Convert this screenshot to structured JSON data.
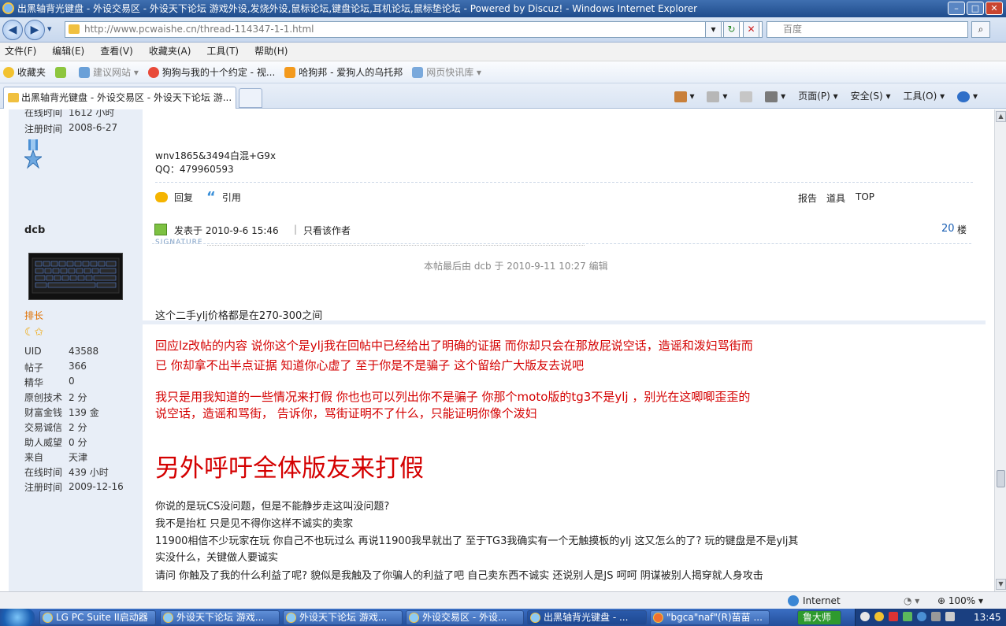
{
  "window": {
    "title": "出黑轴背光键盘 - 外设交易区 - 外设天下论坛 游戏外设,发烧外设,鼠标论坛,键盘论坛,耳机论坛,鼠标垫论坛 - Powered by Discuz! - Windows Internet Explorer",
    "min": "–",
    "max": "□",
    "close": "✕"
  },
  "address": {
    "back": "◀",
    "forward": "▶",
    "dropdown": "▾",
    "url": "http://www.pcwaishe.cn/thread-114347-1-1.html",
    "refresh": "↻",
    "stop": "✕",
    "search_placeholder": "百度",
    "search_btn": "⌕"
  },
  "menu": [
    "文件(F)",
    "编辑(E)",
    "查看(V)",
    "收藏夹(A)",
    "工具(T)",
    "帮助(H)"
  ],
  "favorites_bar": {
    "favorites": "收藏夹",
    "items": [
      "建议网站 ▾",
      "狗狗与我的十个约定 - 视...",
      "哈狗邦 - 爱狗人的乌托邦",
      "网页快讯库 ▾"
    ]
  },
  "tab": {
    "title": "出黑轴背光键盘 - 外设交易区 - 外设天下论坛 游...",
    "cmd": [
      "▾",
      "▾",
      "页面(P) ▾",
      "安全(S) ▾",
      "工具(O) ▾",
      "▾"
    ]
  },
  "prev_post": {
    "online_label": "在线时间",
    "online_value": "1612 小时",
    "reg_label": "注册时间",
    "reg_value": "2008-6-27",
    "signature_label": "SIGNATURE",
    "signature_lines": [
      "wnv1865&3494白混+G9x",
      "QQ：479960593"
    ],
    "reply": "回复",
    "quote": "引用",
    "report": "报告",
    "tools": "道具",
    "top": "TOP"
  },
  "post": {
    "author": "dcb",
    "rank": "排长",
    "stats": [
      {
        "label": "UID",
        "value": "43588"
      },
      {
        "label": "帖子",
        "value": "366"
      },
      {
        "label": "精华",
        "value": "0"
      },
      {
        "label": "原创技术",
        "value": "2 分"
      },
      {
        "label": "财富金钱",
        "value": "139 金"
      },
      {
        "label": "交易诚信",
        "value": "2 分"
      },
      {
        "label": "助人威望",
        "value": "0 分"
      },
      {
        "label": "来自",
        "value": "天津"
      },
      {
        "label": "在线时间",
        "value": "439 小时"
      },
      {
        "label": "注册时间",
        "value": "2009-12-16"
      }
    ],
    "posted_on": "发表于  2010-9-6 15:46",
    "only_author": "只看该作者",
    "floor_num": "20",
    "floor_label": "楼",
    "edited": "本帖最后由  dcb  于  2010-9-11 10:27  编辑",
    "line1": "这个二手ylj价格都是在270-300之间",
    "red1a": "回应lz改帖的内容   说你这个是ylj我在回帖中已经给出了明确的证据    而你却只会在那放屁说空话，造谣和泼妇骂街而",
    "red1b": "已   你却拿不出半点证据    知道你心虚了    至于你是不是骗子  这个留给广大版友去说吧",
    "red2a": "我只是用我知道的一些情况来打假    你也也可以列出你不是骗子  你那个moto版的tg3不是ylj ，别光在这唧唧歪歪的",
    "red2b": "说空话，造谣和骂街，  告诉你，骂街证明不了什么，只能证明你像个泼妇",
    "big": "另外呼吁全体版友来打假",
    "p1": "你说的是玩CS没问题，但是不能静步走这叫没问题?",
    "p2": "我不是抬杠   只是见不得你这样不诚实的卖家",
    "p3": "11900相信不少玩家在玩    你自己不也玩过么    再说11900我早就出了    至于TG3我确实有一个无触摸板的ylj    这又怎么的了?    玩的键盘是不是ylj其",
    "p4": "实没什么，关键做人要诚实",
    "p5": "请问   你触及了我的什么利益了呢?    貌似是我触及了你骗人的利益了吧      自己卖东西不诚实  还说别人是JS     呵呵     阴谋被别人揭穿就人身攻击"
  },
  "status": {
    "zone": "Internet",
    "zoom": "100%"
  },
  "taskbar": {
    "items": [
      "LG PC Suite II启动器",
      "外设天下论坛 游戏...",
      "外设天下论坛 游戏...",
      "外设交易区 - 外设...",
      "出黑轴背光键盘 - ...",
      "\"bgca\"naf\"(R)苗苗 ..."
    ],
    "tray_app": "鲁大师",
    "clock": "13:45"
  },
  "colors": {
    "accent": "#1f4c8c",
    "post_red": "#d40000",
    "sidebar": "#e8eef7",
    "link": "#1a5fb4"
  }
}
